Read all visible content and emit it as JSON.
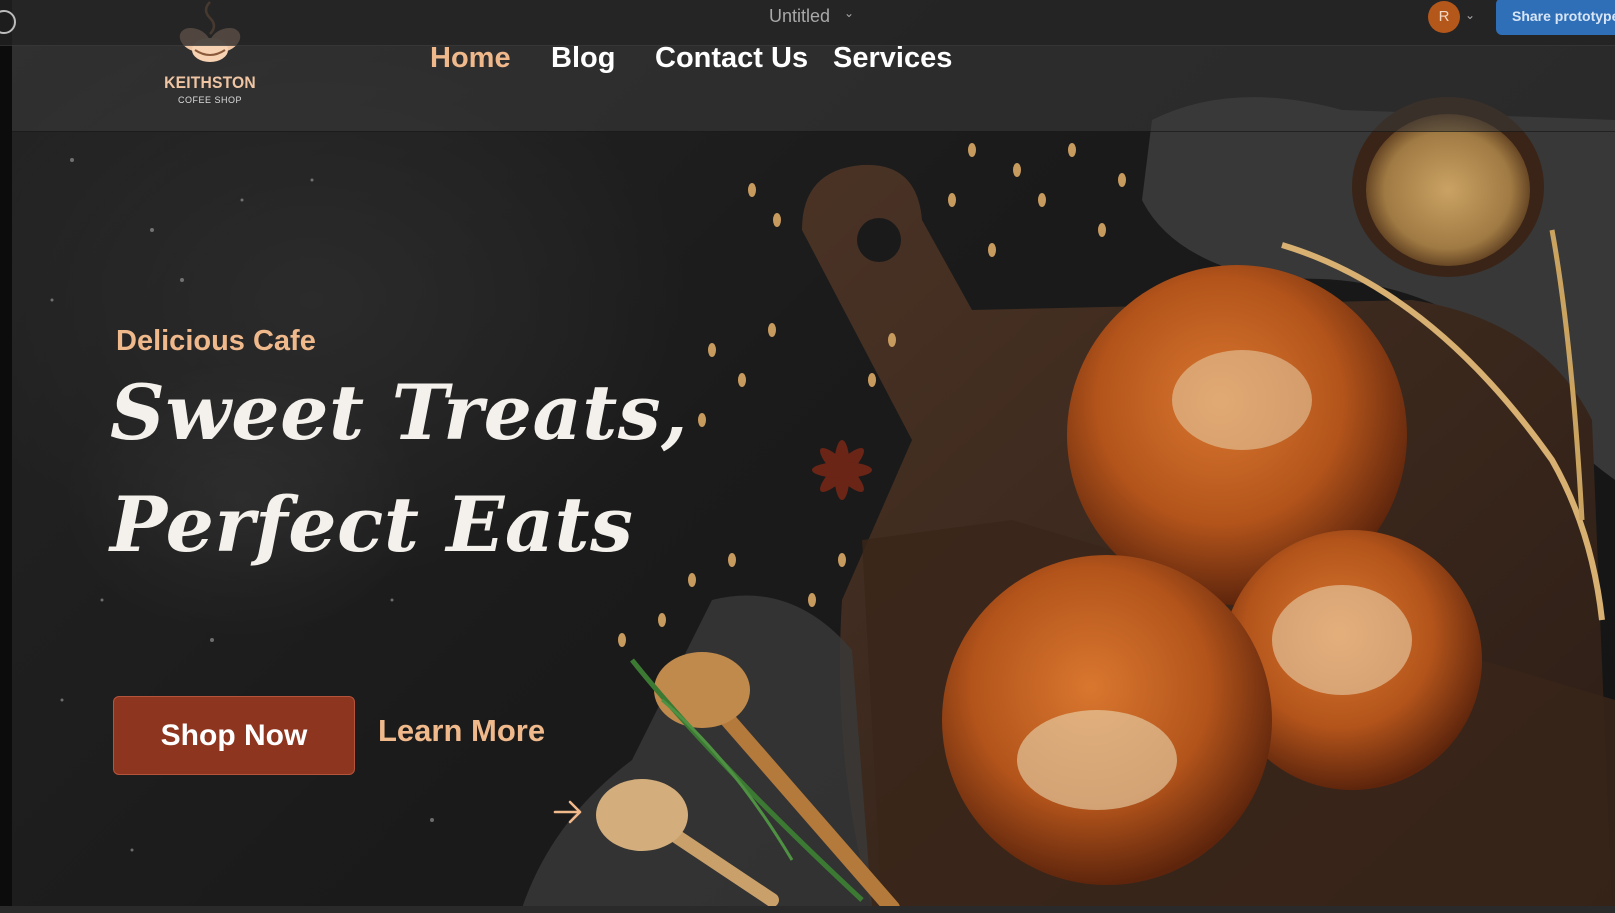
{
  "prototype_bar": {
    "title": "Untitled",
    "avatar_initial": "R",
    "share_label": "Share prototype",
    "title_menu_icon": "chevron-down-icon",
    "avatar_menu_icon": "chevron-down-icon"
  },
  "brand": {
    "name": "KEITHSTON",
    "tagline": "COFEE SHOP",
    "icon": "coffee-beans-logo",
    "accent_color": "#f0b98c"
  },
  "nav": {
    "items": [
      {
        "label": "Home",
        "active": true
      },
      {
        "label": "Blog",
        "active": false
      },
      {
        "label": "Contact Us",
        "active": false
      },
      {
        "label": "Services",
        "active": false
      }
    ]
  },
  "hero": {
    "eyebrow": "Delicious Cafe",
    "headline_line1": "Sweet Treats,",
    "headline_line2": "Perfect Eats",
    "primary_button": "Shop Now",
    "secondary_link": "Learn More",
    "arrow_icon": "arrow-right-icon",
    "button_color": "#8e3520"
  }
}
